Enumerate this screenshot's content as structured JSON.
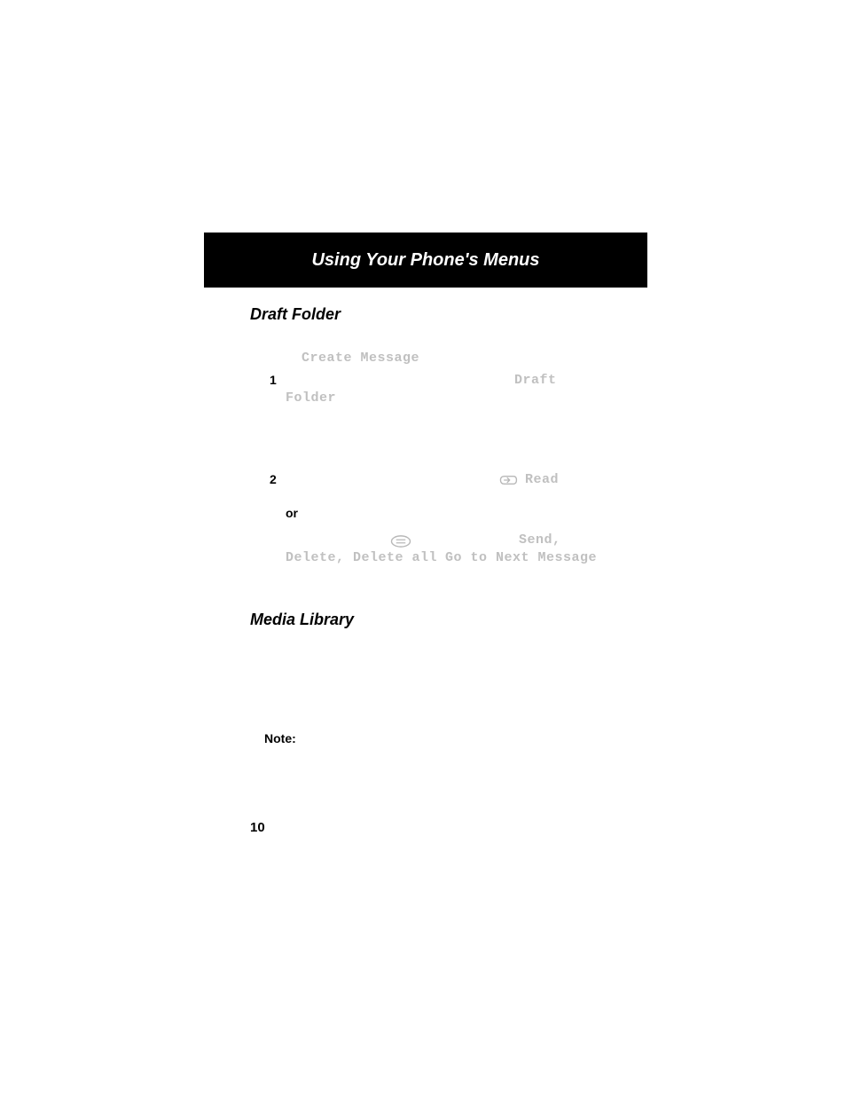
{
  "banner": {
    "title": "Using Your Phone's Menus"
  },
  "sections": {
    "draft_title": "Draft Folder",
    "media_title": "Media Library"
  },
  "content": {
    "create_message": "Create Message",
    "step1_num": "1",
    "draft": "Draft",
    "folder": "Folder",
    "step2_num": "2",
    "read": "Read",
    "or": "or",
    "send": "Send,",
    "delete_line_a": "Delete, Delete all",
    "delete_line_b": "Go to Next Message",
    "note": "Note:",
    "page_number": "10"
  }
}
